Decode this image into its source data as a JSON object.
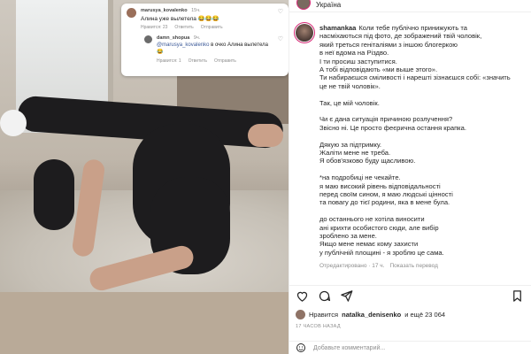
{
  "header": {
    "location": "Україна"
  },
  "overlay": {
    "comment": {
      "user": "marusya_kovalenko",
      "time": "15ч.",
      "text": "Алина уже вылетела 😂😂😂",
      "likes": "Нравится: 23",
      "reply_label": "Ответить",
      "send_label": "Отправить"
    },
    "reply": {
      "user": "damn_shopua",
      "time": "9ч.",
      "mention": "@marusya_kovalenko",
      "text": "в очко Алина вылетела 😂",
      "likes": "Нравится: 1",
      "reply_label": "Ответить",
      "send_label": "Отправить"
    }
  },
  "post": {
    "username": "shamankaa",
    "caption_lines": [
      "Коли тебе публічно принижують та",
      "насміхаються під фото, де зображений твій чоловік,",
      "який треться геніталіями з іншою блогеркою",
      "в неї вдома на Різдво.",
      "І ти просиш заступитися.",
      "А тобі відповідають «ми выше этого».",
      "Ти набираєшся сміливості і нарешті зізнаєшся собі: «значить",
      "це не твій чоловік».",
      "",
      "Так, це мій чоловік.",
      "",
      "Чи є дана ситуація причиною розлучення?",
      "Звісно ні. Це просто феєрична остання крапка.",
      "",
      "Дякую за підтримку.",
      "Жаліти мене не треба.",
      "Я обов'язково буду щасливою.",
      "",
      "*на подробиці не чекайте.",
      "я маю високий рівень відповідальності",
      "перед своїм сином, я маю людські цінності",
      "та повагу до тієї родини, яка в мене була.",
      "",
      "до останнього не хотіла виносити",
      "ані крихти особистого сюди, але вибір",
      "зроблено за мене.",
      "Якщо мене немає кому захисти",
      "у публічній площині - я зроблю це сама."
    ],
    "meta": {
      "edited": "Отредактировано · 17 ч.",
      "see_translation": "Показать перевод"
    },
    "likes_text": "Нравится",
    "liker": "natalka_denisenko",
    "likes_suffix": "и ещё 23 064",
    "time_ago": "17 ЧАСОВ НАЗАД",
    "comment_placeholder": "Добавьте комментарий..."
  },
  "icons": {
    "like": "heart-icon",
    "comment": "comment-icon",
    "share": "share-icon",
    "save": "bookmark-icon",
    "emoji": "emoji-icon"
  },
  "colors": {
    "story_ring": "#d62976",
    "text": "#262626",
    "muted": "#8e8e8e"
  }
}
